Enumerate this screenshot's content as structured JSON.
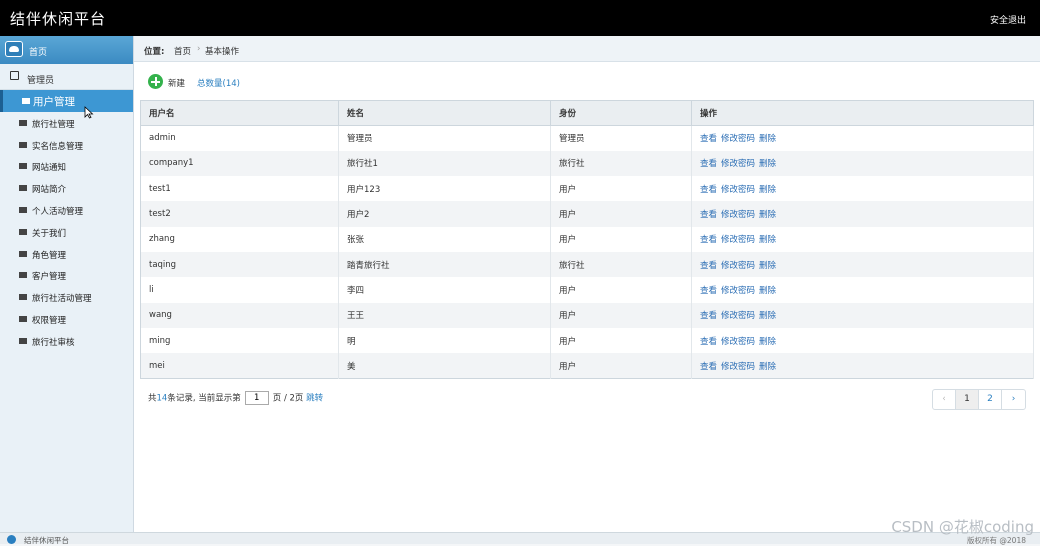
{
  "header": {
    "title": "结伴休闲平台",
    "logout": "安全退出"
  },
  "sidebar": {
    "home": "首页",
    "group": "管理员",
    "items": [
      {
        "label": "用户管理",
        "active": true
      },
      {
        "label": "旅行社管理"
      },
      {
        "label": "实名信息管理"
      },
      {
        "label": "网站通知"
      },
      {
        "label": "网站简介"
      },
      {
        "label": "个人活动管理"
      },
      {
        "label": "关于我们"
      },
      {
        "label": "角色管理"
      },
      {
        "label": "客户管理"
      },
      {
        "label": "旅行社活动管理"
      },
      {
        "label": "权限管理"
      },
      {
        "label": "旅行社审核"
      }
    ]
  },
  "breadcrumb": {
    "title": "位置:",
    "home": "首页",
    "separator": "›",
    "page": "基本操作"
  },
  "toolbar": {
    "new_label": "新建",
    "total": "总数量(14)"
  },
  "table": {
    "headers": [
      "用户名",
      "姓名",
      "身份",
      "操作"
    ],
    "ops": [
      "查看",
      "修改密码",
      "删除"
    ],
    "rows": [
      [
        "admin",
        "管理员",
        "管理员"
      ],
      [
        "company1",
        "旅行社1",
        "旅行社"
      ],
      [
        "test1",
        "用户123",
        "用户"
      ],
      [
        "test2",
        "用户2",
        "用户"
      ],
      [
        "zhang",
        "张张",
        "用户"
      ],
      [
        "taqing",
        "踏青旅行社",
        "旅行社"
      ],
      [
        "li",
        "李四",
        "用户"
      ],
      [
        "wang",
        "王王",
        "用户"
      ],
      [
        "ming",
        "明",
        "用户"
      ],
      [
        "mei",
        "美",
        "用户"
      ]
    ]
  },
  "pagination": {
    "prefix": "共",
    "count": "14",
    "suffix": "条记录,  当前显示第",
    "current": "1",
    "pages_text": "页 / 2页",
    "jump": "跳转",
    "prev": "‹",
    "page_numbers": [
      "1",
      "2"
    ],
    "next": "›"
  },
  "footer": {
    "name": "结伴休闲平台",
    "copyright": "版权所有 @2018"
  },
  "watermark": "CSDN @花椒coding",
  "colors": {
    "topbar": "#000000",
    "accent": "#3d97d3",
    "link": "#2a6db4",
    "new_icon": "#34b24c"
  }
}
